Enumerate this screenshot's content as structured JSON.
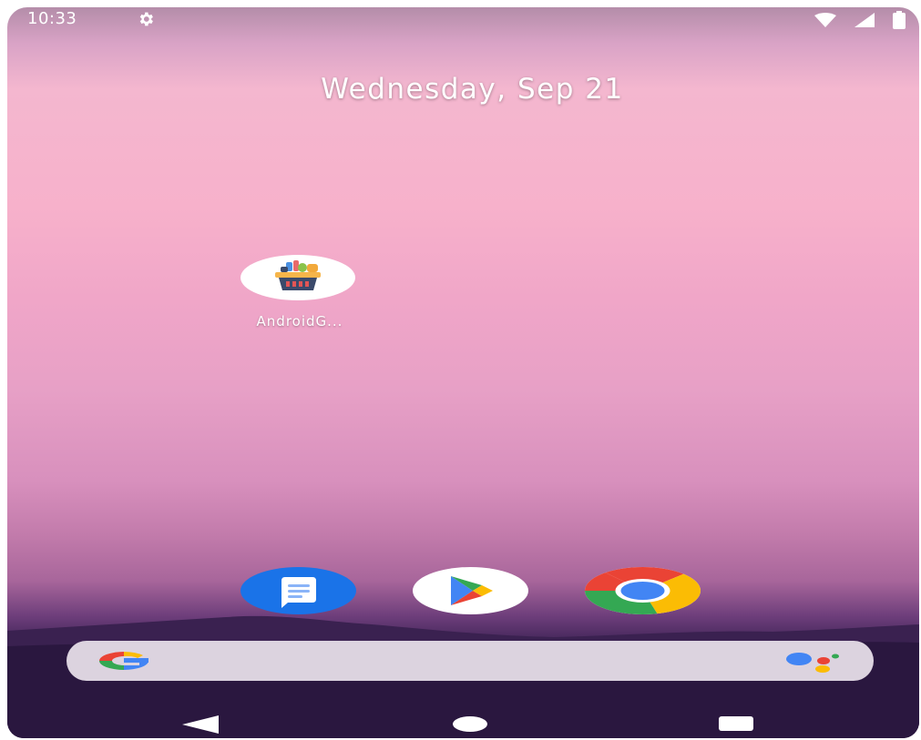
{
  "status_bar": {
    "time": "10:33",
    "icons": [
      "settings-gear-icon",
      "wifi-icon",
      "cellular-signal-icon",
      "battery-icon"
    ]
  },
  "home": {
    "date": "Wednesday, Sep 21",
    "apps": [
      {
        "label": "AndroidG...",
        "icon": "grocery-basket-icon"
      }
    ]
  },
  "dock": {
    "apps": [
      {
        "icon": "messages-icon"
      },
      {
        "icon": "play-store-icon"
      },
      {
        "icon": "chrome-icon"
      }
    ]
  },
  "search_bar": {
    "icons": [
      "google-g-icon",
      "google-assistant-icon"
    ]
  },
  "nav_bar": {
    "buttons": [
      "back-icon",
      "home-icon",
      "recents-icon"
    ]
  },
  "colors": {
    "messages_blue": "#1a73e8",
    "search_bar_bg": "#dcd3df"
  }
}
